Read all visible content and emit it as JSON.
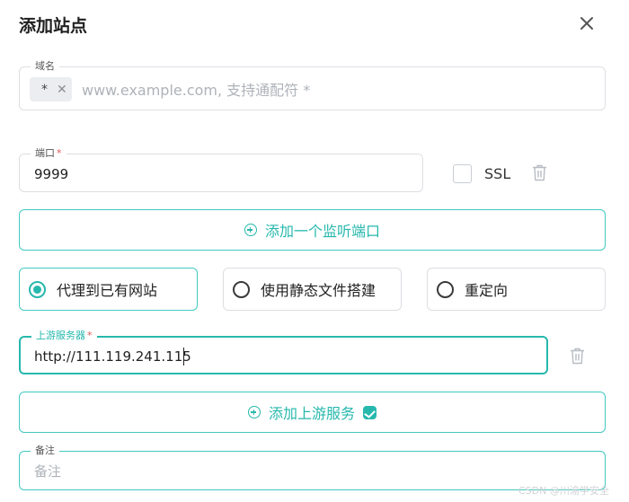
{
  "dialog": {
    "title": "添加站点"
  },
  "domain": {
    "legend": "域名",
    "chip": "*",
    "placeholder": "www.example.com, 支持通配符 *"
  },
  "port": {
    "legend": "端口",
    "required_mark": "*",
    "value": "9999",
    "ssl_label": "SSL",
    "ssl_checked": false
  },
  "add_port_button": "添加一个监听端口",
  "mode_options": [
    {
      "label": "代理到已有网站",
      "selected": true
    },
    {
      "label": "使用静态文件搭建",
      "selected": false
    },
    {
      "label": "重定向",
      "selected": false
    }
  ],
  "upstream": {
    "legend": "上游服务器",
    "required_mark": "*",
    "value": "http://111.119.241.115"
  },
  "add_upstream_button": "添加上游服务",
  "remark": {
    "legend": "备注",
    "placeholder": "备注"
  },
  "watermark": "CSDN @川渝学安全",
  "colors": {
    "accent": "#27b8ad",
    "border": "#dcdfe3",
    "required": "#e25555"
  },
  "icons": [
    "close-icon",
    "chip-remove-icon",
    "trash-icon",
    "plus-circle-icon",
    "radio-icon",
    "pro-badge-icon"
  ]
}
